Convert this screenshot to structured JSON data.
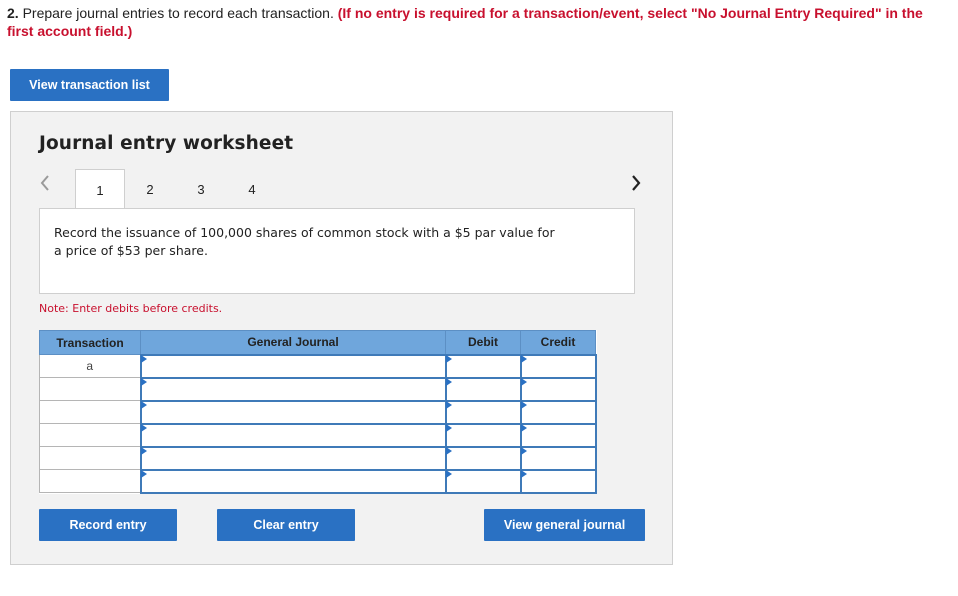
{
  "instructions": {
    "number": "2.",
    "text": " Prepare journal entries to record each transaction. ",
    "emphasis": "(If no entry is required for a transaction/event, select \"No Journal Entry Required\" in the first account field.)"
  },
  "view_transaction_list_label": "View transaction list",
  "worksheet": {
    "title": "Journal entry worksheet",
    "tabs": [
      "1",
      "2",
      "3",
      "4"
    ],
    "active_tab": "1",
    "description": "Record the issuance of 100,000 shares of common stock with a $5 par value for a price of $53 per share.",
    "note": "Note: Enter debits before credits.",
    "table": {
      "headers": {
        "transaction": "Transaction",
        "general_journal": "General Journal",
        "debit": "Debit",
        "credit": "Credit"
      },
      "rows": [
        {
          "transaction": "a",
          "account": "",
          "debit": "",
          "credit": ""
        },
        {
          "transaction": "",
          "account": "",
          "debit": "",
          "credit": ""
        },
        {
          "transaction": "",
          "account": "",
          "debit": "",
          "credit": ""
        },
        {
          "transaction": "",
          "account": "",
          "debit": "",
          "credit": ""
        },
        {
          "transaction": "",
          "account": "",
          "debit": "",
          "credit": ""
        },
        {
          "transaction": "",
          "account": "",
          "debit": "",
          "credit": ""
        }
      ]
    },
    "buttons": {
      "record": "Record entry",
      "clear": "Clear entry",
      "view_general": "View general journal"
    }
  },
  "icons": {
    "prev": "chevron-left-icon",
    "next": "chevron-right-icon"
  },
  "colors": {
    "button": "#2a71c3",
    "header": "#6fa6dc",
    "alert": "#c8102e"
  }
}
